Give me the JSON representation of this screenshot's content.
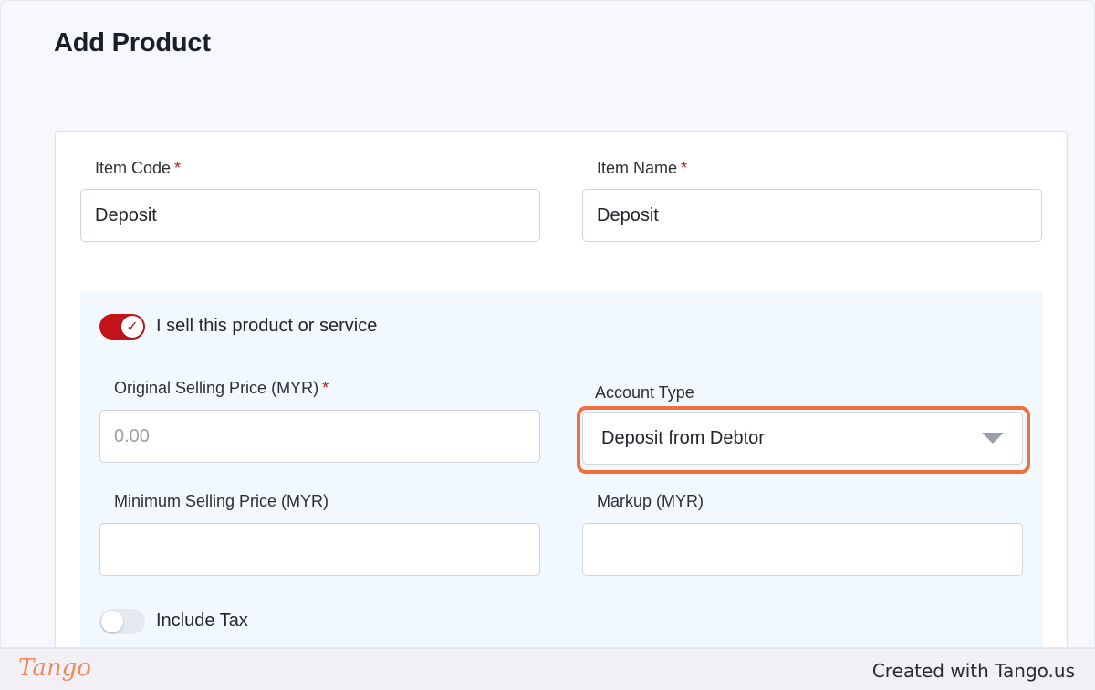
{
  "page": {
    "title": "Add Product"
  },
  "form": {
    "item_code": {
      "label": "Item Code",
      "required_mark": "*",
      "value": "Deposit"
    },
    "item_name": {
      "label": "Item Name",
      "required_mark": "*",
      "value": "Deposit"
    },
    "sell_toggle": {
      "label": "I sell this product or service",
      "checked": true
    },
    "original_selling_price": {
      "label": "Original Selling Price (MYR)",
      "required_mark": "*",
      "placeholder": "0.00",
      "value": ""
    },
    "account_type": {
      "label": "Account Type",
      "selected": "Deposit from Debtor"
    },
    "minimum_selling_price": {
      "label": "Minimum Selling Price (MYR)",
      "value": ""
    },
    "markup": {
      "label": "Markup (MYR)",
      "value": ""
    },
    "include_tax": {
      "label": "Include Tax",
      "checked": false
    }
  },
  "footer": {
    "logo": "Tango",
    "credit": "Created with Tango.us"
  },
  "colors": {
    "accent_red": "#c3141b",
    "highlight_orange": "#f26f3d",
    "section_bg": "#f1f8fe",
    "page_bg": "#f6f8fd"
  },
  "icons": {
    "toggle_check": "check-icon",
    "select_caret": "caret-down-icon"
  }
}
